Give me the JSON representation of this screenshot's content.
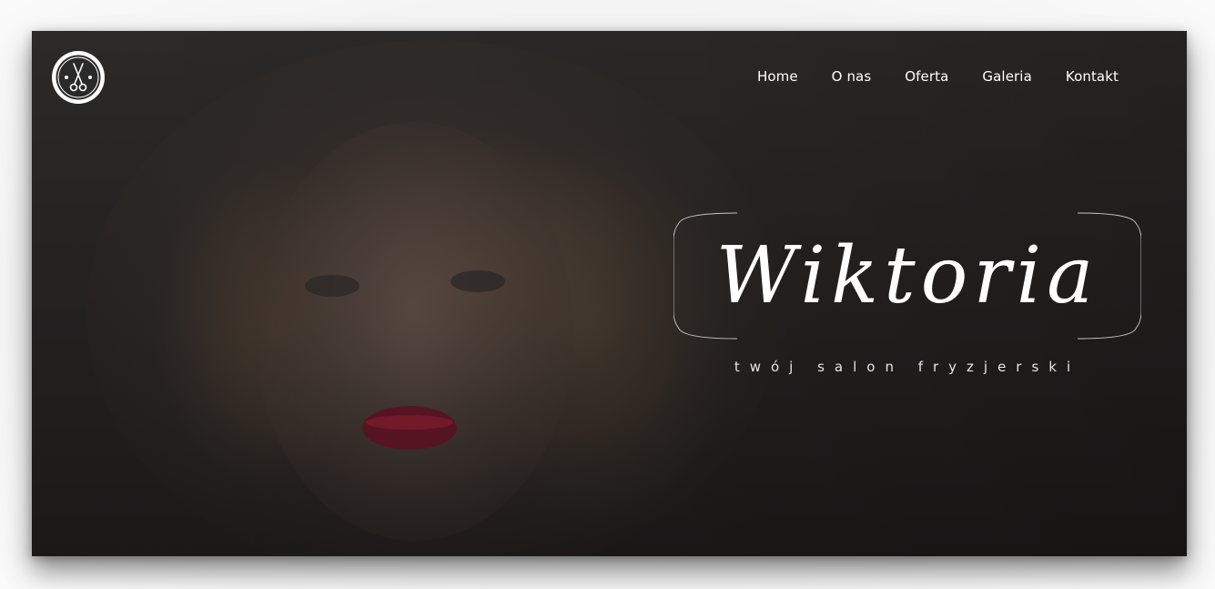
{
  "nav": {
    "items": [
      {
        "label": "Home"
      },
      {
        "label": "O nas"
      },
      {
        "label": "Oferta"
      },
      {
        "label": "Galeria"
      },
      {
        "label": "Kontakt"
      }
    ]
  },
  "hero": {
    "title": "Wiktoria",
    "tagline": "twój salon fryzjerski"
  },
  "logo": {
    "icon": "scissors-icon"
  },
  "colors": {
    "text": "#ffffff",
    "overlay": "#232120"
  }
}
